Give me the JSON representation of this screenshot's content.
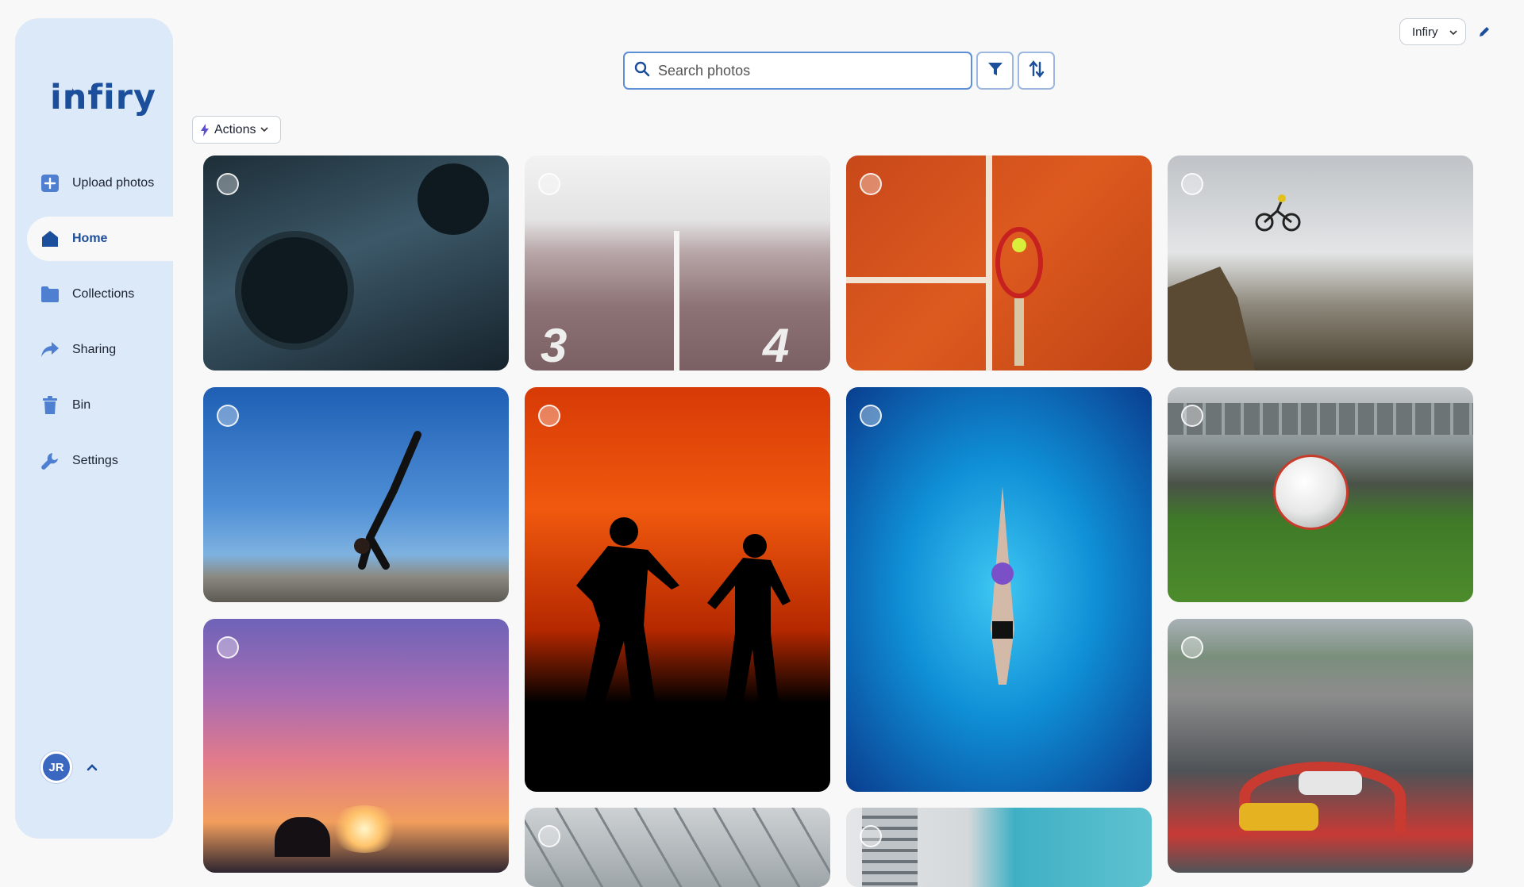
{
  "app": {
    "name": "infiry"
  },
  "sidebar": {
    "items": [
      {
        "label": "Upload photos",
        "icon": "plus-square-icon"
      },
      {
        "label": "Home",
        "icon": "home-icon",
        "active": true
      },
      {
        "label": "Collections",
        "icon": "folder-icon"
      },
      {
        "label": "Sharing",
        "icon": "share-icon"
      },
      {
        "label": "Bin",
        "icon": "trash-icon"
      },
      {
        "label": "Settings",
        "icon": "wrench-icon"
      }
    ],
    "user": {
      "initials": "JR"
    }
  },
  "header": {
    "workspace": "Infiry",
    "search_placeholder": "Search photos"
  },
  "toolbar": {
    "actions_label": "Actions"
  },
  "photos": [
    {
      "subject": "weightlifting barbell",
      "selected": false
    },
    {
      "subject": "running track lanes 3 and 4",
      "selected": false
    },
    {
      "subject": "tennis racket on clay court",
      "selected": false
    },
    {
      "subject": "mountain biker jumping",
      "selected": false
    },
    {
      "subject": "yoga pose by the sea",
      "selected": false
    },
    {
      "subject": "runners silhouette at sunset",
      "selected": false
    },
    {
      "subject": "swimmer in pool",
      "selected": false
    },
    {
      "subject": "soccer ball in stadium",
      "selected": false
    },
    {
      "subject": "athlete at sunset beach",
      "selected": false
    },
    {
      "subject": "race cars on track",
      "selected": false
    },
    {
      "subject": "stadium roof structure",
      "selected": false
    },
    {
      "subject": "city buildings",
      "selected": false
    }
  ],
  "colors": {
    "accent": "#1b4e9b",
    "sidebar_bg": "#dce9f8",
    "page_bg": "#f8f8f8"
  }
}
